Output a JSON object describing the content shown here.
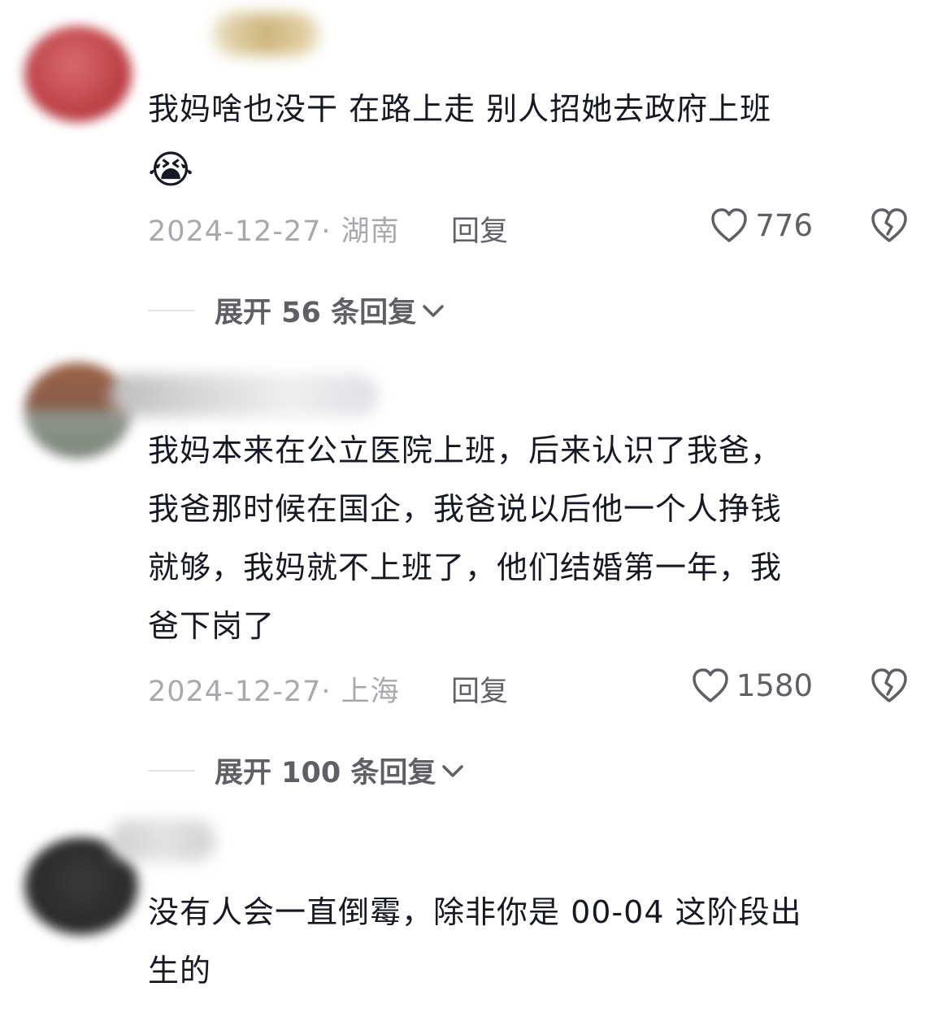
{
  "comments": [
    {
      "text": "我妈啥也没干 在路上走 别人招她去政府上班",
      "emoji": "😭",
      "date_location": "2024-12-27· 湖南",
      "reply_label": "回复",
      "likes": "776",
      "expand_label": "展开 56 条回复"
    },
    {
      "text": "我妈本来在公立医院上班，后来认识了我爸，\n我爸那时候在国企，我爸说以后他一个人挣钱\n就够，我妈就不上班了，他们结婚第一年，我\n爸下岗了",
      "date_location": "2024-12-27· 上海",
      "reply_label": "回复",
      "likes": "1580",
      "expand_label": "展开 100 条回复"
    },
    {
      "text": "没有人会一直倒霉，除非你是 00-04 这阶段出\n生的"
    }
  ],
  "icons": {
    "like": "heart-outline-icon",
    "dislike": "broken-heart-icon",
    "expand": "chevron-down-icon"
  },
  "colors": {
    "text": "#161823",
    "meta": "#a8a9ad",
    "action": "#5f6066",
    "divider": "#e3e3e5"
  }
}
